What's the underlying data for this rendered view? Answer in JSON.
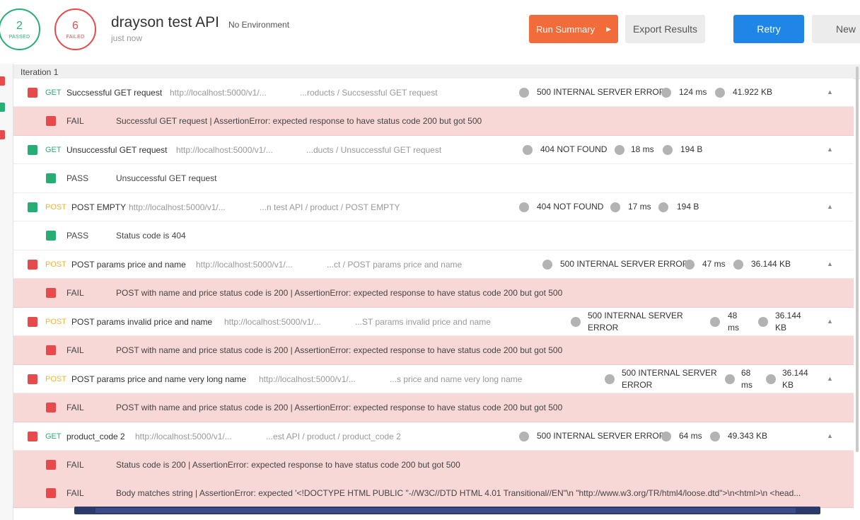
{
  "summary": {
    "passed_count": "2",
    "passed_label": "PASSED",
    "failed_count": "6",
    "failed_label": "FAILED",
    "collection_title": "drayson test API",
    "environment": "No Environment",
    "run_time": "just now"
  },
  "toolbar": {
    "run_summary_label": "Run Summary",
    "export_results_label": "Export Results",
    "retry_label": "Retry",
    "new_label": "New"
  },
  "iteration": {
    "label": "Iteration 1"
  },
  "colors": {
    "pass": "#27ae75",
    "fail": "#e64a4a",
    "get": "#27ae75",
    "post": "#f0b33a",
    "run_button": "#f26b3a",
    "retry_button": "#1f86e8",
    "fail_row_bg": "#f8d7d7"
  },
  "requests": [
    {
      "method": "GET",
      "name": "Succsessful GET request",
      "url": "http://localhost:5000/v1/...",
      "path": "...roducts / Succsessful GET request",
      "status": "500 INTERNAL SERVER ERROR",
      "time": "124 ms",
      "size": "41.922 KB",
      "state": "fail",
      "results": [
        {
          "result": "FAIL",
          "message": "Successful GET request | AssertionError: expected response to have status code 200 but got 500"
        }
      ]
    },
    {
      "method": "GET",
      "name": "Unsuccessful GET request",
      "url": "http://localhost:5000/v1/...",
      "path": "...ducts / Unsuccessful GET request",
      "status": "404 NOT FOUND",
      "time": "18 ms",
      "size": "194 B",
      "state": "pass",
      "results": [
        {
          "result": "PASS",
          "message": "Unsuccessful GET request"
        }
      ]
    },
    {
      "method": "POST",
      "name": "POST EMPTY",
      "url": "http://localhost:5000/v1/...",
      "path": "...n test API / product / POST EMPTY",
      "status": "404 NOT FOUND",
      "time": "17 ms",
      "size": "194 B",
      "state": "pass",
      "results": [
        {
          "result": "PASS",
          "message": "Status code is 404"
        }
      ]
    },
    {
      "method": "POST",
      "name": "POST params price and name",
      "url": "http://localhost:5000/v1/...",
      "path": "...ct / POST params price and name",
      "status": "500 INTERNAL SERVER ERROR",
      "time": "47 ms",
      "size": "36.144 KB",
      "state": "fail",
      "results": [
        {
          "result": "FAIL",
          "message": "POST with name and price status code is 200 | AssertionError: expected response to have status code 200 but got 500"
        }
      ]
    },
    {
      "method": "POST",
      "name": "POST params invalid price and name",
      "url": "http://localhost:5000/v1/...",
      "path": "...ST params invalid price and name",
      "status_line1": "500 INTERNAL SERVER",
      "status_line2": "ERROR",
      "time_line1": "48",
      "time_line2": "ms",
      "size_line1": "36.144",
      "size_line2": "KB",
      "state": "fail",
      "results": [
        {
          "result": "FAIL",
          "message": "POST with name and price status code is 200 | AssertionError: expected response to have status code 200 but got 500"
        }
      ]
    },
    {
      "method": "POST",
      "name": "POST params price and name very long name",
      "url": "http://localhost:5000/v1/...",
      "path": "...s price and name very long name",
      "status_line1": "500 INTERNAL SERVER",
      "status_line2": "ERROR",
      "time_line1": "68",
      "time_line2": "ms",
      "size_line1": "36.144",
      "size_line2": "KB",
      "state": "fail",
      "results": [
        {
          "result": "FAIL",
          "message": "POST with name and price status code is 200 | AssertionError: expected response to have status code 200 but got 500"
        }
      ]
    },
    {
      "method": "GET",
      "name": "product_code 2",
      "url": "http://localhost:5000/v1/...",
      "path": "...est API / product / product_code 2",
      "status": "500 INTERNAL SERVER ERROR",
      "time": "64 ms",
      "size": "49.343 KB",
      "state": "fail",
      "results": [
        {
          "result": "FAIL",
          "message": "Status code is 200 | AssertionError: expected response to have status code 200 but got 500"
        },
        {
          "result": "FAIL",
          "message": "Body matches string | AssertionError: expected '<!DOCTYPE HTML PUBLIC \"-//W3C//DTD HTML 4.01 Transitional//EN\"\\n \"http://www.w3.org/TR/html4/loose.dtd\">\\n<html>\\n <head..."
        }
      ]
    }
  ]
}
